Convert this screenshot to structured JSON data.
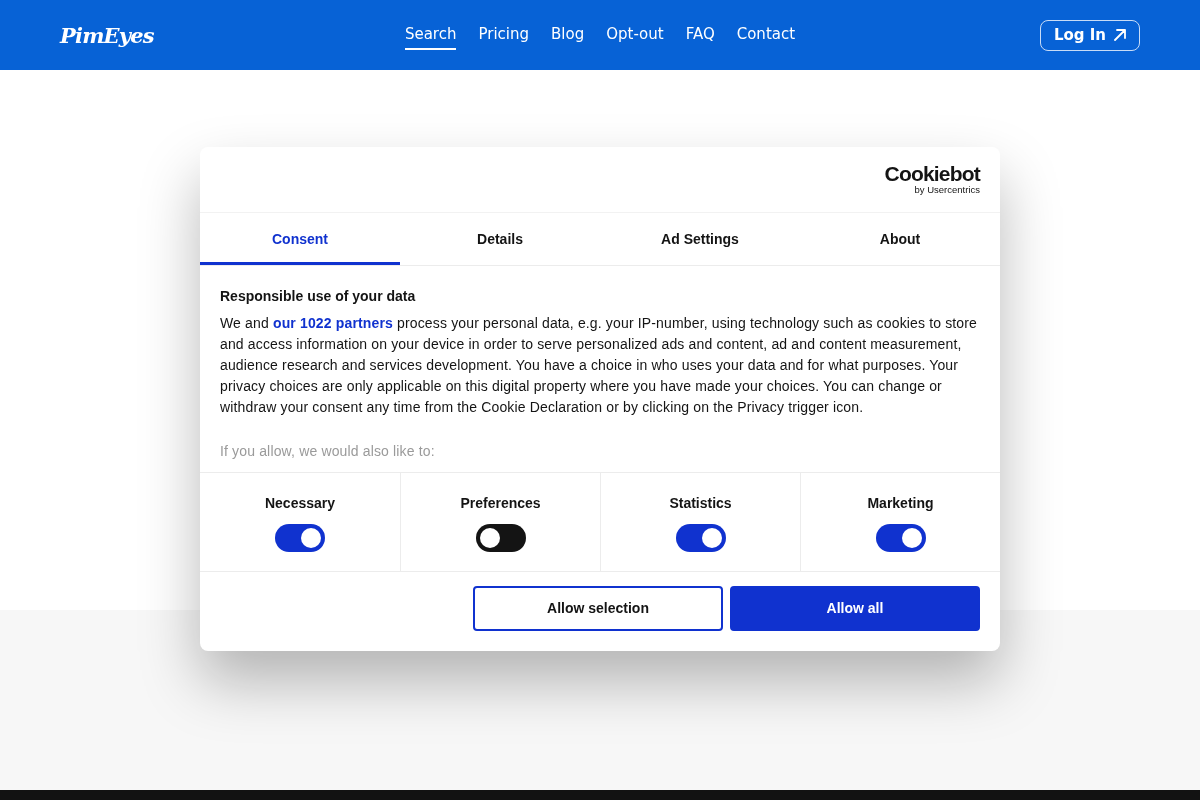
{
  "header": {
    "logo": "PimEyes",
    "nav": [
      {
        "label": "Search",
        "selected": true
      },
      {
        "label": "Pricing",
        "selected": false
      },
      {
        "label": "Blog",
        "selected": false
      },
      {
        "label": "Opt-out",
        "selected": false
      },
      {
        "label": "FAQ",
        "selected": false
      },
      {
        "label": "Contact",
        "selected": false
      }
    ],
    "login_button": "Log In"
  },
  "consent_dialog": {
    "brand": {
      "name": "Cookiebot",
      "byline": "by Usercentrics"
    },
    "tabs": [
      {
        "label": "Consent",
        "selected": true
      },
      {
        "label": "Details",
        "selected": false
      },
      {
        "label": "Ad Settings",
        "selected": false
      },
      {
        "label": "About",
        "selected": false
      }
    ],
    "heading": "Responsible use of your data",
    "body": {
      "before_link": "We and ",
      "link": "our 1022 partners",
      "after_link": " process your personal data, e.g. your IP-number, using technology such as cookies to store and access information on your device in order to serve personalized ads and content, ad and content measurement, audience research and services development. You have a choice in who uses your data and for what purposes. Your privacy choices are only applicable on this digital property where you have made your choices. You can change or withdraw your consent any time from the Cookie Declaration or by clicking on the Privacy trigger icon."
    },
    "faded_text": "If you allow, we would also like to:",
    "toggles": [
      {
        "label": "Necessary",
        "on": true
      },
      {
        "label": "Preferences",
        "on": false
      },
      {
        "label": "Statistics",
        "on": true
      },
      {
        "label": "Marketing",
        "on": true
      }
    ],
    "buttons": [
      {
        "label": "Allow selection",
        "kind": "outline"
      },
      {
        "label": "Allow all",
        "kind": "primary"
      }
    ]
  }
}
